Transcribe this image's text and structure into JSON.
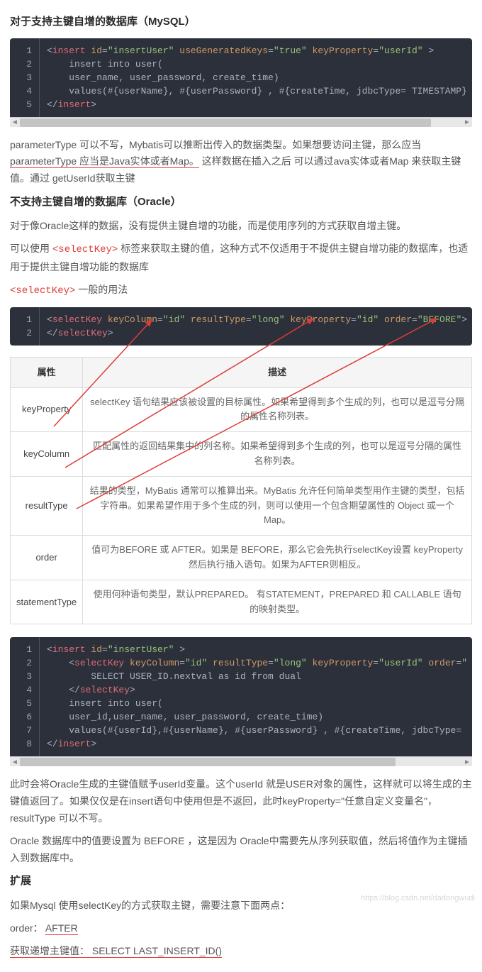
{
  "h1": "对于支持主键自增的数据库（MySQL）",
  "code1": {
    "lines": 5,
    "tokens": [
      [
        [
          "<",
          "p"
        ],
        [
          "insert ",
          "t"
        ],
        [
          "id",
          "a"
        ],
        [
          "=",
          "p"
        ],
        [
          "\"insertUser\"",
          "s"
        ],
        [
          " ",
          "p"
        ],
        [
          "useGeneratedKeys",
          "a"
        ],
        [
          "=",
          "p"
        ],
        [
          "\"true\"",
          "s"
        ],
        [
          " ",
          "p"
        ],
        [
          "keyProperty",
          "a"
        ],
        [
          "=",
          "p"
        ],
        [
          "\"userId\"",
          "s"
        ],
        [
          " >",
          "p"
        ]
      ],
      [
        [
          "    insert into user(",
          "p"
        ]
      ],
      [
        [
          "    user_name, user_password, create_time)",
          "p"
        ]
      ],
      [
        [
          "    values(#{userName}, #{userPassword} , #{createTime, jdbcType= TIMESTAMP}",
          "p"
        ]
      ],
      [
        [
          "</",
          "p"
        ],
        [
          "insert",
          "t"
        ],
        [
          ">",
          "p"
        ]
      ]
    ],
    "thumbLeft": 14,
    "thumbWidth": 580
  },
  "p1a": "parameterType 可以不写，Mybatis可以推断出传入的数据类型。如果想要访问主键，那么应当",
  "p1b_u": "parameterType 应当是Java实体或者Map。",
  "p1b_rest": "这样数据在插入之后 可以通过ava实体或者Map 来获取主键值。通过 getUserId获取主键",
  "h2": "不支持主键自增的数据库（Oracle）",
  "p2": "对于像Oracle这样的数据，没有提供主键自增的功能，而是使用序列的方式获取自增主键。",
  "p3a": "可以使用 ",
  "p3tag": "<selectKey>",
  "p3b": " 标签来获取主键的值，这种方式不仅适用于不提供主键自增功能的数据库，也适用于提供主键自增功能的数据库",
  "p4tag": "<selectKey>",
  "p4b": " 一般的用法",
  "code2": {
    "lines": 2,
    "tokens": [
      [
        [
          "<",
          "p"
        ],
        [
          "selectKey ",
          "t"
        ],
        [
          "keyColumn",
          "a"
        ],
        [
          "=",
          "p"
        ],
        [
          "\"id\"",
          "s"
        ],
        [
          " ",
          "p"
        ],
        [
          "resultType",
          "a"
        ],
        [
          "=",
          "p"
        ],
        [
          "\"long\"",
          "s"
        ],
        [
          " ",
          "p"
        ],
        [
          "keyProperty",
          "a"
        ],
        [
          "=",
          "p"
        ],
        [
          "\"id\"",
          "s"
        ],
        [
          " ",
          "p"
        ],
        [
          "order",
          "a"
        ],
        [
          "=",
          "p"
        ],
        [
          "\"BEFORE\"",
          "s"
        ],
        [
          ">",
          "p"
        ]
      ],
      [
        [
          "</",
          "p"
        ],
        [
          "selectKey",
          "t"
        ],
        [
          ">",
          "p"
        ]
      ]
    ]
  },
  "table": {
    "h1": "属性",
    "h2": "描述",
    "rows": [
      {
        "a": "keyProperty",
        "d": "selectKey 语句结果应该被设置的目标属性。如果希望得到多个生成的列，也可以是逗号分隔的属性名称列表。"
      },
      {
        "a": "keyColumn",
        "d": "匹配属性的返回结果集中的列名称。如果希望得到多个生成的列，也可以是逗号分隔的属性名称列表。"
      },
      {
        "a": "resultType",
        "d": "结果的类型，MyBatis 通常可以推算出来。MyBatis 允许任何简单类型用作主键的类型，包括字符串。如果希望作用于多个生成的列，则可以使用一个包含期望属性的 Object 或一个 Map。"
      },
      {
        "a": "order",
        "d": "值可为BEFORE 或 AFTER。如果是 BEFORE，那么它会先执行selectKey设置 keyProperty 然后执行插入语句。如果为AFTER则相反。"
      },
      {
        "a": "statementType",
        "d": "使用何种语句类型，默认PREPARED。 有STATEMENT，PREPARED 和 CALLABLE 语句的映射类型。"
      }
    ]
  },
  "code3": {
    "lines": 8,
    "tokens": [
      [
        [
          "<",
          "p"
        ],
        [
          "insert ",
          "t"
        ],
        [
          "id",
          "a"
        ],
        [
          "=",
          "p"
        ],
        [
          "\"insertUser\"",
          "s"
        ],
        [
          " >",
          "p"
        ]
      ],
      [
        [
          "    <",
          "p"
        ],
        [
          "selectKey ",
          "t"
        ],
        [
          "keyColumn",
          "a"
        ],
        [
          "=",
          "p"
        ],
        [
          "\"id\"",
          "s"
        ],
        [
          " ",
          "p"
        ],
        [
          "resultType",
          "a"
        ],
        [
          "=",
          "p"
        ],
        [
          "\"long\"",
          "s"
        ],
        [
          " ",
          "p"
        ],
        [
          "keyProperty",
          "a"
        ],
        [
          "=",
          "p"
        ],
        [
          "\"userId\"",
          "s"
        ],
        [
          " ",
          "p"
        ],
        [
          "order",
          "a"
        ],
        [
          "=",
          "p"
        ],
        [
          "\"",
          "s"
        ]
      ],
      [
        [
          "        SELECT USER_ID.nextval as id from dual",
          "p"
        ]
      ],
      [
        [
          "    </",
          "p"
        ],
        [
          "selectKey",
          "t"
        ],
        [
          ">",
          "p"
        ]
      ],
      [
        [
          "    insert into user(",
          "p"
        ]
      ],
      [
        [
          "    user_id,user_name, user_password, create_time)",
          "p"
        ]
      ],
      [
        [
          "    values(#{userId},#{userName}, #{userPassword} , #{createTime, jdbcType= ",
          "p"
        ]
      ],
      [
        [
          "</",
          "p"
        ],
        [
          "insert",
          "t"
        ],
        [
          ">",
          "p"
        ]
      ]
    ],
    "thumbLeft": 14,
    "thumbWidth": 530
  },
  "p5": "此时会将Oracle生成的主键值赋予userId变量。这个userId 就是USER对象的属性，这样就可以将生成的主键值返回了。如果仅仅是在insert语句中使用但是不返回，此时keyProperty=\"任意自定义变量名\"，resultType 可以不写。",
  "p6": "Oracle 数据库中的值要设置为 BEFORE ，这是因为 Oracle中需要先从序列获取值，然后将值作为主键插入到数据库中。",
  "h3": "扩展",
  "p7": "如果Mysql 使用selectKey的方式获取主键，需要注意下面两点：",
  "p8_label": "order：  ",
  "p8_val": "AFTER",
  "p9_label": "获取递增主键值： ",
  "p9_val": "SELECT LAST_INSERT_ID()",
  "watermark": "https://blog.csdn.net/dadongwudi"
}
